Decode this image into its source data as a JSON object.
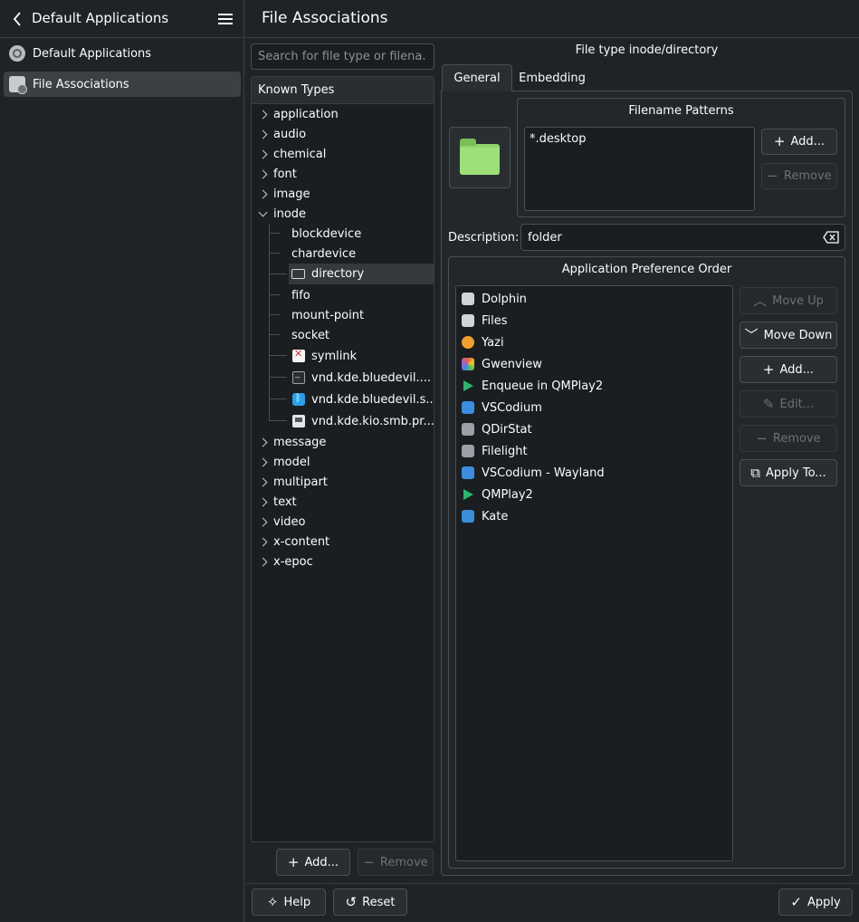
{
  "sidebar": {
    "title": "Default Applications",
    "items": [
      {
        "label": "Default Applications",
        "icon": "gear-icon"
      },
      {
        "label": "File Associations",
        "icon": "file-associations-icon"
      }
    ]
  },
  "header": {
    "title": "File Associations"
  },
  "search": {
    "placeholder": "Search for file type or filena..."
  },
  "tree": {
    "header": "Known Types",
    "items": [
      {
        "label": "application"
      },
      {
        "label": "audio"
      },
      {
        "label": "chemical"
      },
      {
        "label": "font"
      },
      {
        "label": "image"
      },
      {
        "label": "inode"
      },
      {
        "label": "blockdevice"
      },
      {
        "label": "chardevice"
      },
      {
        "label": "directory"
      },
      {
        "label": "fifo"
      },
      {
        "label": "mount-point"
      },
      {
        "label": "socket"
      },
      {
        "label": "symlink"
      },
      {
        "label": "vnd.kde.bluedevil...."
      },
      {
        "label": "vnd.kde.bluedevil.s..."
      },
      {
        "label": "vnd.kde.kio.smb.pr..."
      },
      {
        "label": "message"
      },
      {
        "label": "model"
      },
      {
        "label": "multipart"
      },
      {
        "label": "text"
      },
      {
        "label": "video"
      },
      {
        "label": "x-content"
      },
      {
        "label": "x-epoc"
      }
    ],
    "add_label": "Add...",
    "remove_label": "Remove"
  },
  "details": {
    "file_type_label": "File type inode/directory",
    "tabs": [
      {
        "label": "General"
      },
      {
        "label": "Embedding"
      }
    ],
    "filename_patterns": {
      "title": "Filename Patterns",
      "items": [
        "*.desktop"
      ],
      "add_label": "Add...",
      "remove_label": "Remove"
    },
    "description": {
      "label": "Description:",
      "value": "folder"
    },
    "app_pref": {
      "title": "Application Preference Order",
      "apps": [
        {
          "label": "Dolphin",
          "color": "#d0d4d8"
        },
        {
          "label": "Files",
          "color": "#d0d4d8"
        },
        {
          "label": "Yazi",
          "color": "#f0a030"
        },
        {
          "label": "Gwenview",
          "color": "#e0663c"
        },
        {
          "label": "Enqueue in QMPlay2",
          "color": "#2fb36f"
        },
        {
          "label": "VSCodium",
          "color": "#3c8ce0"
        },
        {
          "label": "QDirStat",
          "color": "#9aa0a6"
        },
        {
          "label": "Filelight",
          "color": "#9aa0a6"
        },
        {
          "label": "VSCodium - Wayland",
          "color": "#3c8ce0"
        },
        {
          "label": "QMPlay2",
          "color": "#2fb36f"
        },
        {
          "label": "Kate",
          "color": "#3a8fd8"
        }
      ],
      "buttons": {
        "move_up": "Move Up",
        "move_down": "Move Down",
        "add": "Add...",
        "edit": "Edit...",
        "remove": "Remove",
        "apply_to": "Apply To..."
      }
    }
  },
  "footer": {
    "help": "Help",
    "reset": "Reset",
    "apply": "Apply"
  }
}
